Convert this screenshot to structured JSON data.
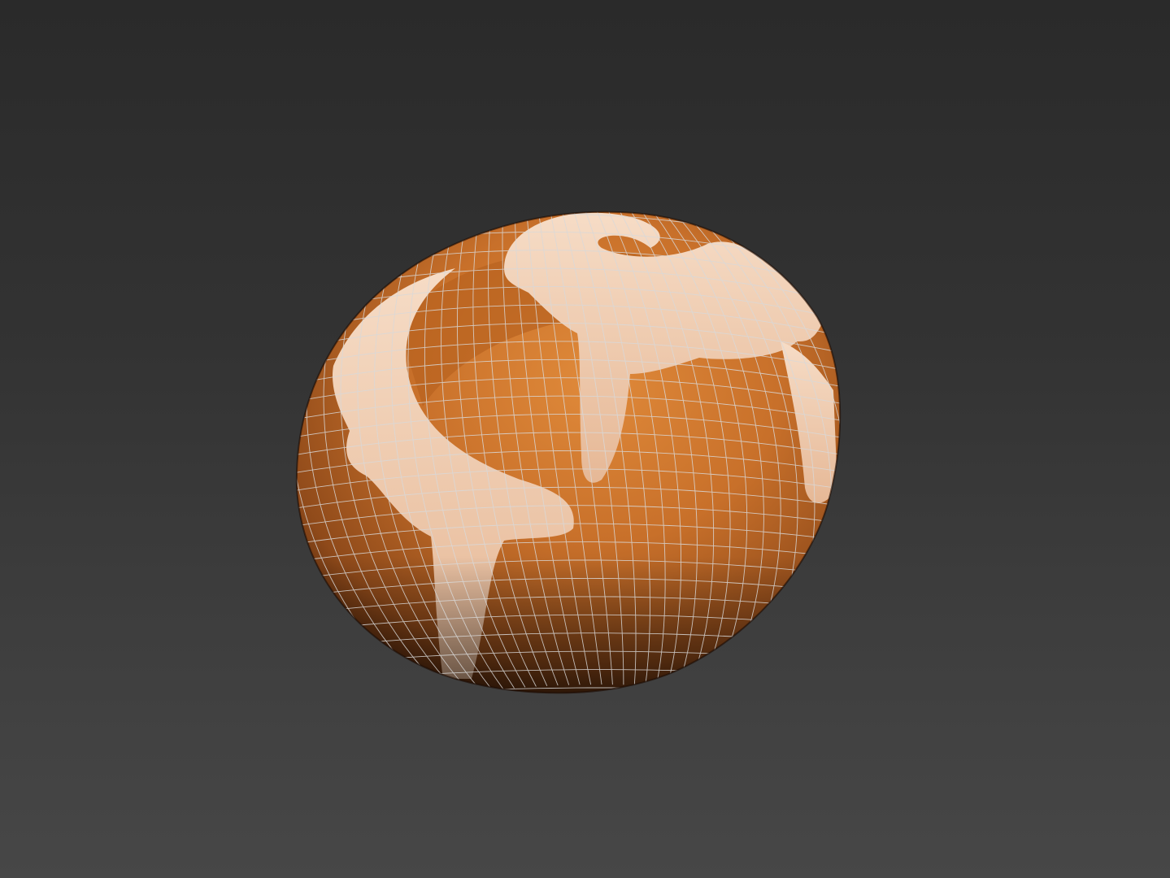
{
  "viewport": {
    "background_top": "#2a2a2a",
    "background_bottom": "#474747"
  },
  "model": {
    "name": "cinnamon-roll",
    "dough_color": "#c8702a",
    "dough_shadow": "#5a2a0c",
    "icing_color": "#f0cdb0",
    "wireframe_color": "#d9d9d9"
  }
}
